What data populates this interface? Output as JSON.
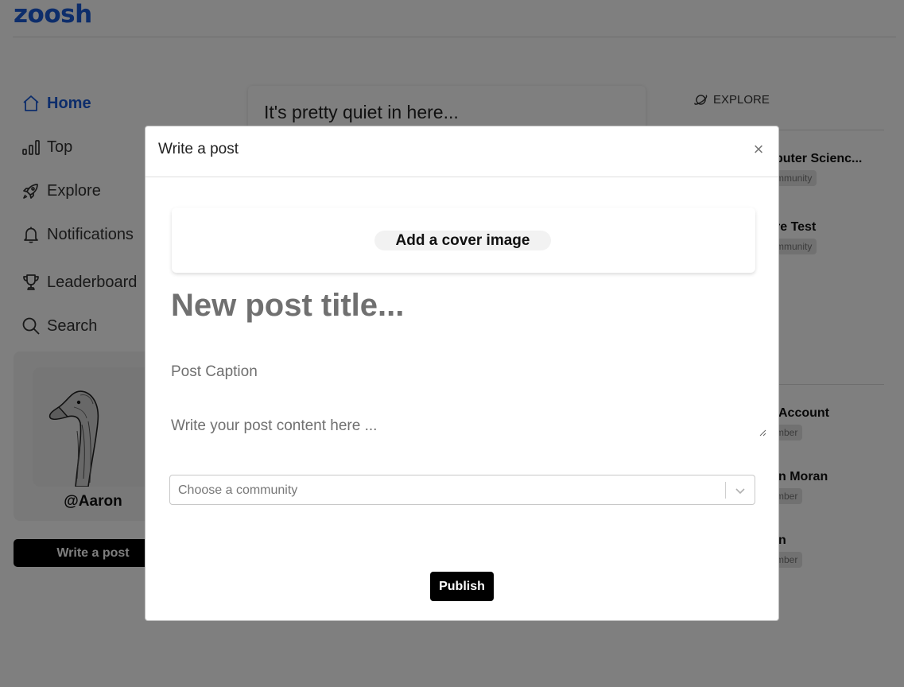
{
  "brand": {
    "logo": "zoosh"
  },
  "nav": {
    "items": [
      {
        "label": "Home",
        "icon": "home-icon",
        "active": true
      },
      {
        "label": "Top",
        "icon": "bar-chart-icon"
      },
      {
        "label": "Explore",
        "icon": "rocket-icon"
      },
      {
        "label": "Notifications",
        "icon": "bell-icon"
      },
      {
        "label": "Leaderboard",
        "icon": "trophy-icon"
      },
      {
        "label": "Search",
        "icon": "search-icon"
      }
    ]
  },
  "profile": {
    "username": "@Aaron"
  },
  "sidebar_write_button": "Write a post",
  "feed": {
    "empty_message": "It's pretty quiet in here..."
  },
  "right_panel": {
    "explore_label": "EXPLORE",
    "communities": [
      {
        "name": "puter Scienc...",
        "badge": "mmunity"
      },
      {
        "name": "re Test",
        "badge": "mmunity"
      }
    ],
    "members": [
      {
        "name": "Account",
        "badge": "mber"
      },
      {
        "name": "n Moran",
        "badge": "mber"
      },
      {
        "name": "n",
        "badge": "mber"
      }
    ]
  },
  "modal": {
    "title": "Write a post",
    "close_symbol": "×",
    "cover_button": "Add a cover image",
    "title_placeholder": "New post title...",
    "caption_placeholder": "Post Caption",
    "content_placeholder": "Write your post content here ...",
    "community_placeholder": "Choose a community",
    "publish_button": "Publish"
  },
  "colors": {
    "brand_blue": "#1a5bd6",
    "overlay": "rgba(0,0,0,0.5)",
    "button_black": "#000000"
  }
}
